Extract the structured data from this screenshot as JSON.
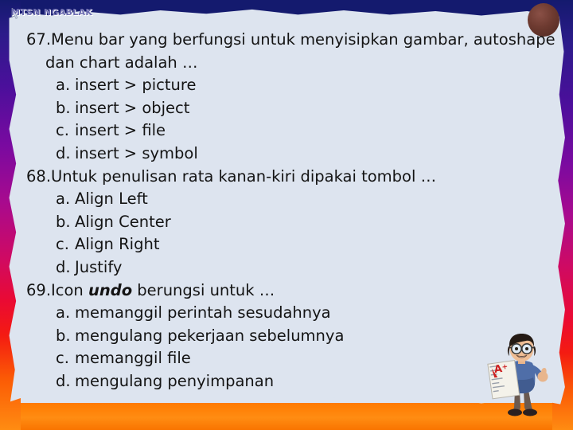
{
  "slide": {
    "header_title": "MTSN NGABLAK",
    "background_color": "#dde4ef",
    "top_band_color": "#141a6e",
    "bottom_band_color": "#ff8c12",
    "header_text_color": "#6b6bb0",
    "body_text_color": "#141414"
  },
  "decorations": {
    "brown_circle": "brown-circle-bullet",
    "mascot_alt": "cartoon-student-holding-A-plus-test-paper-thumbs-up",
    "cursor_mark": "mouse-pointer-mark"
  },
  "questions": [
    {
      "number": "67.",
      "stem_line_1": "Menu bar yang berfungsi untuk menyisipkan gambar, autoshape",
      "stem_line_2": "dan chart adalah …",
      "options": [
        {
          "letter": "a.",
          "text": "insert > picture"
        },
        {
          "letter": "b.",
          "text": "insert > object"
        },
        {
          "letter": "c.",
          "text": "insert > file"
        },
        {
          "letter": "d.",
          "text": "insert > symbol"
        }
      ]
    },
    {
      "number": "68.",
      "stem_line_1": "Untuk penulisan rata kanan-kiri dipakai tombol …",
      "stem_line_2": "",
      "options": [
        {
          "letter": "a.",
          "text": "Align Left"
        },
        {
          "letter": "b.",
          "text": "Align Center"
        },
        {
          "letter": "c.",
          "text": "Align Right"
        },
        {
          "letter": "d.",
          "text": "Justify"
        }
      ]
    },
    {
      "number": "69.",
      "stem_prefix": "Icon ",
      "stem_emphasis": "undo",
      "stem_suffix": " berungsi untuk …",
      "options": [
        {
          "letter": "a.",
          "text": "memanggil perintah sesudahnya"
        },
        {
          "letter": "b.",
          "text": "mengulang pekerjaan sebelumnya"
        },
        {
          "letter": "c.",
          "text": "memanggil file"
        },
        {
          "letter": "d.",
          "text": "mengulang penyimpanan"
        }
      ]
    }
  ]
}
